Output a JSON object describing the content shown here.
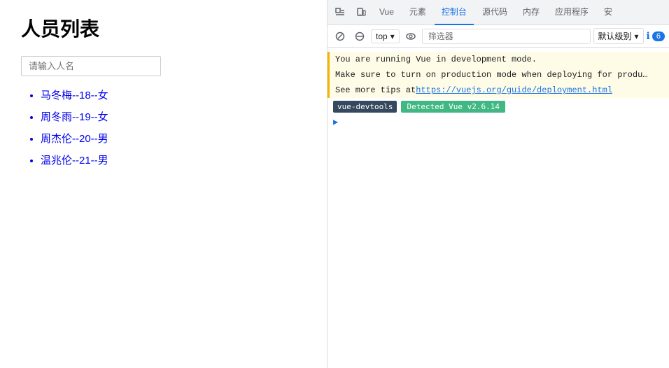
{
  "left": {
    "title": "人员列表",
    "search_placeholder": "请输入人名",
    "persons": [
      "马冬梅--18--女",
      "周冬雨--19--女",
      "周杰伦--20--男",
      "温兆伦--21--男"
    ]
  },
  "devtools": {
    "nav_tabs": [
      {
        "label": "Vue",
        "active": false
      },
      {
        "label": "元素",
        "active": false
      },
      {
        "label": "控制台",
        "active": true
      },
      {
        "label": "源代码",
        "active": false
      },
      {
        "label": "内存",
        "active": false
      },
      {
        "label": "应用程序",
        "active": false
      },
      {
        "label": "安",
        "active": false
      }
    ],
    "toolbar": {
      "top_label": "top",
      "filter_placeholder": "筛选器",
      "level_label": "默认级别",
      "error_count": "6"
    },
    "console_lines": [
      "You are running Vue in development mode.",
      "Make sure to turn on production mode when deploying for produ…",
      "See more tips at https://vuejs.org/guide/deployment.html"
    ],
    "vue_devtools_badge": "vue-devtools",
    "detected_badge": "Detected Vue v2.6.14",
    "link": "https://vuejs.org/guide/deployment.html"
  }
}
